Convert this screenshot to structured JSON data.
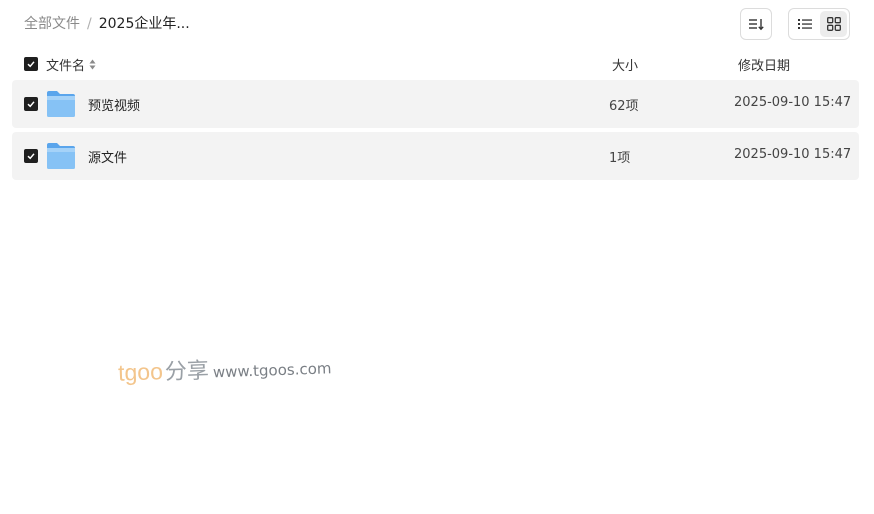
{
  "breadcrumb": {
    "root": "全部文件",
    "separator": "/",
    "current": "2025企业年..."
  },
  "toolbar": {
    "sort_icon": "sort-list-icon",
    "list_view_icon": "list-view-icon",
    "grid_view_icon": "grid-view-icon",
    "active_view": "grid"
  },
  "table": {
    "headers": {
      "name": "文件名",
      "size": "大小",
      "date": "修改日期"
    },
    "rows": [
      {
        "name": "预览视频",
        "size": "62项",
        "date": "2025-09-10 15:47",
        "checked": true,
        "icon": "folder-icon"
      },
      {
        "name": "源文件",
        "size": "1项",
        "date": "2025-09-10 15:47",
        "checked": true,
        "icon": "folder-icon"
      }
    ]
  },
  "watermark": {
    "brand": "tgoo",
    "cn": "分享",
    "url": "www.tgoos.com"
  },
  "colors": {
    "row_bg": "#f3f3f3",
    "checkbox": "#1f1f1f",
    "folder": "#6cb3f0",
    "watermark_brand": "#f3c58c"
  }
}
